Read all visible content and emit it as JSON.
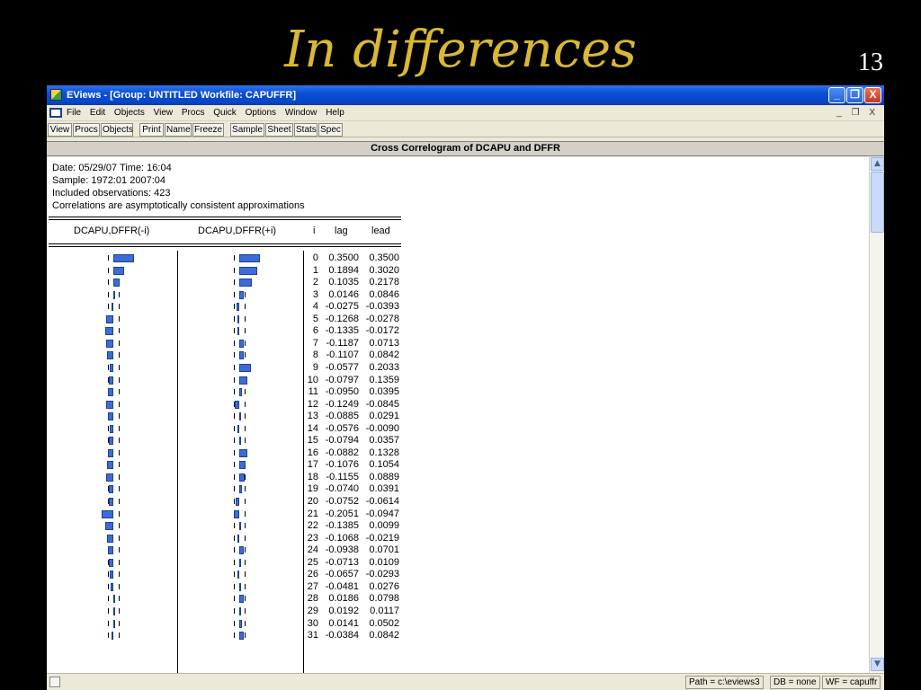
{
  "slide": {
    "title": "In differences",
    "number": "13"
  },
  "window": {
    "title": "EViews - [Group: UNTITLED   Workfile: CAPUFFR]",
    "controls": [
      "_",
      "❐",
      "X"
    ]
  },
  "menu": {
    "items": [
      "File",
      "Edit",
      "Objects",
      "View",
      "Procs",
      "Quick",
      "Options",
      "Window",
      "Help"
    ],
    "mdi_controls": "_ ❐ X"
  },
  "toolbar": {
    "buttons": [
      "View",
      "Procs",
      "Objects",
      "Print",
      "Name",
      "Freeze",
      "Sample",
      "Sheet",
      "Stats",
      "Spec"
    ]
  },
  "view_title": "Cross Correlogram of DCAPU and DFFR",
  "info": {
    "date": "Date: 05/29/07   Time: 16:04",
    "sample": "Sample: 1972:01 2007:04",
    "observations": "Included observations: 423",
    "note": "Correlations are asymptotically consistent approximations"
  },
  "columns": {
    "lag_graph": "DCAPU,DFFR(-i)",
    "lead_graph": "DCAPU,DFFR(+i)",
    "i": "i",
    "lag": "lag",
    "lead": "lead"
  },
  "chart_data": {
    "type": "table",
    "columns": [
      "i",
      "lag",
      "lead"
    ],
    "rows": [
      {
        "i": "0",
        "lag": "0.3500",
        "lead": "0.3500"
      },
      {
        "i": "1",
        "lag": "0.1894",
        "lead": "0.3020"
      },
      {
        "i": "2",
        "lag": "0.1035",
        "lead": "0.2178"
      },
      {
        "i": "3",
        "lag": "0.0146",
        "lead": "0.0846"
      },
      {
        "i": "4",
        "lag": "-0.0275",
        "lead": "-0.0393"
      },
      {
        "i": "5",
        "lag": "-0.1268",
        "lead": "-0.0278"
      },
      {
        "i": "6",
        "lag": "-0.1335",
        "lead": "-0.0172"
      },
      {
        "i": "7",
        "lag": "-0.1187",
        "lead": "0.0713"
      },
      {
        "i": "8",
        "lag": "-0.1107",
        "lead": "0.0842"
      },
      {
        "i": "9",
        "lag": "-0.0577",
        "lead": "0.2033"
      },
      {
        "i": "10",
        "lag": "-0.0797",
        "lead": "0.1359"
      },
      {
        "i": "11",
        "lag": "-0.0950",
        "lead": "0.0395"
      },
      {
        "i": "12",
        "lag": "-0.1249",
        "lead": "-0.0845"
      },
      {
        "i": "13",
        "lag": "-0.0885",
        "lead": "0.0291"
      },
      {
        "i": "14",
        "lag": "-0.0576",
        "lead": "-0.0090"
      },
      {
        "i": "15",
        "lag": "-0.0794",
        "lead": "0.0357"
      },
      {
        "i": "16",
        "lag": "-0.0882",
        "lead": "0.1328"
      },
      {
        "i": "17",
        "lag": "-0.1076",
        "lead": "0.1054"
      },
      {
        "i": "18",
        "lag": "-0.1155",
        "lead": "0.0889"
      },
      {
        "i": "19",
        "lag": "-0.0740",
        "lead": "0.0391"
      },
      {
        "i": "20",
        "lag": "-0.0752",
        "lead": "-0.0614"
      },
      {
        "i": "21",
        "lag": "-0.2051",
        "lead": "-0.0947"
      },
      {
        "i": "22",
        "lag": "-0.1385",
        "lead": "0.0099"
      },
      {
        "i": "23",
        "lag": "-0.1068",
        "lead": "-0.0219"
      },
      {
        "i": "24",
        "lag": "-0.0938",
        "lead": "0.0701"
      },
      {
        "i": "25",
        "lag": "-0.0713",
        "lead": "0.0109"
      },
      {
        "i": "26",
        "lag": "-0.0657",
        "lead": "-0.0293"
      },
      {
        "i": "27",
        "lag": "-0.0481",
        "lead": "0.0276"
      },
      {
        "i": "28",
        "lag": "0.0186",
        "lead": "0.0798"
      },
      {
        "i": "29",
        "lag": "0.0192",
        "lead": "0.0117"
      },
      {
        "i": "30",
        "lag": "0.0141",
        "lead": "0.0502"
      },
      {
        "i": "31",
        "lag": "-0.0384",
        "lead": "0.0842"
      }
    ]
  },
  "statusbar": {
    "path": "Path = c:\\eviews3",
    "db": "DB = none",
    "wf": "WF = capuffr"
  },
  "colors": {
    "slide_background": "#000000",
    "title": "#d9b833",
    "bar": "#3e6bd6",
    "titlebar": "#0a4fd6"
  }
}
